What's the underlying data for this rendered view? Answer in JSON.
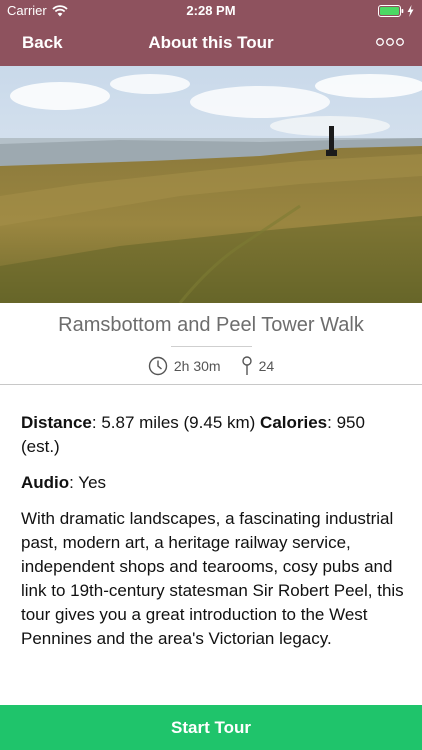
{
  "status_bar": {
    "carrier": "Carrier",
    "time": "2:28 PM",
    "icons": [
      "wifi-icon",
      "battery-icon",
      "charging-bolt-icon"
    ]
  },
  "nav": {
    "back_label": "Back",
    "title": "About this Tour",
    "more_icon": "more-options-icon"
  },
  "tour": {
    "title": "Ramsbottom and Peel Tower Walk",
    "duration": "2h 30m",
    "stops": "24",
    "distance_label": "Distance",
    "distance_value": ": 5.87 miles (9.45 km) ",
    "calories_label": "Calories",
    "calories_value": ": 950 (est.)",
    "audio_label": "Audio",
    "audio_value": ": Yes",
    "description": "With dramatic landscapes, a fascinating industrial past, modern art, a heritage railway service, independent shops and tearooms, cosy pubs and link to 19th-century statesman Sir Robert Peel, this tour gives you a great introduction to the West Pennines and the area's Victorian legacy."
  },
  "start_button_label": "Start Tour",
  "colors": {
    "header": "#8e525e",
    "start_button": "#1fc46b",
    "battery": "#4cd964"
  }
}
